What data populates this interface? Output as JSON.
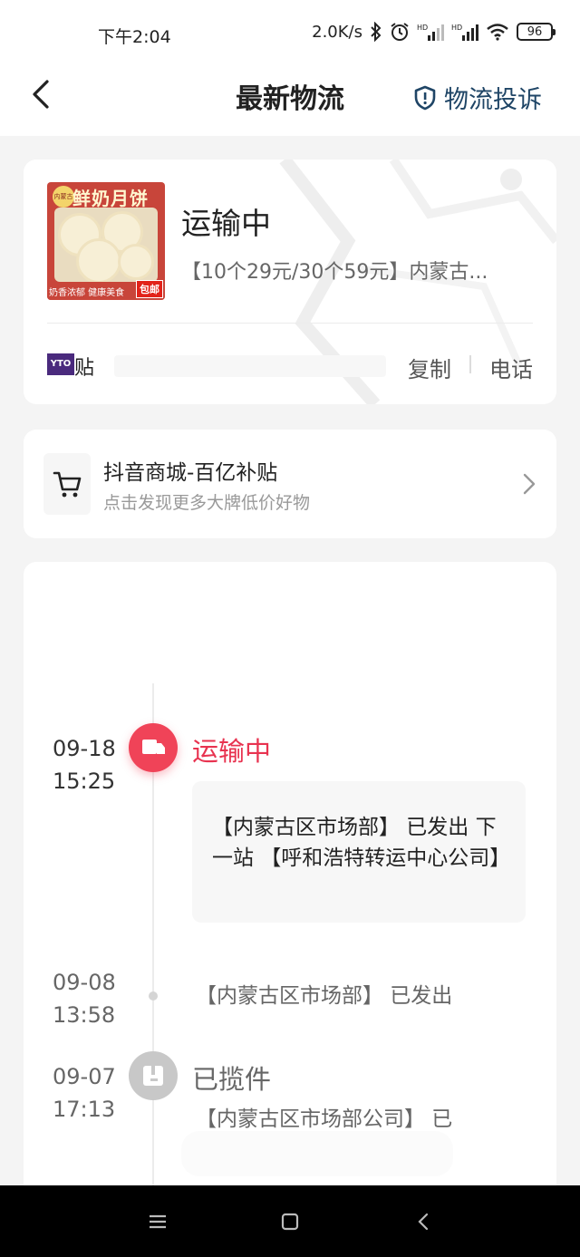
{
  "status_bar": {
    "time": "下午2:04",
    "net_speed": "2.0K/s",
    "battery": "96",
    "icons": [
      "bluetooth-icon",
      "alarm-icon",
      "signal-icon",
      "signal-icon",
      "wifi-icon",
      "battery-icon"
    ]
  },
  "header": {
    "title": "最新物流",
    "complaint_label": "物流投诉",
    "icons": [
      "back-icon",
      "shield-icon"
    ]
  },
  "product": {
    "thumb_title": "鲜奶月饼",
    "thumb_brand": "内蒙古",
    "thumb_footer": "奶香浓郁 健康美食",
    "thumb_badge": "包邮",
    "status": "运输中",
    "name": "【10个29元/30个59元】内蒙古...",
    "courier_logo_text": "YTO",
    "courier_suffix": "贴",
    "copy_label": "复制",
    "phone_label": "电话"
  },
  "promo": {
    "title": "抖音商城-百亿补贴",
    "subtitle": "点击发现更多大牌低价好物",
    "icons": [
      "cart-icon",
      "chevron-right-icon"
    ]
  },
  "timeline": [
    {
      "date": "09-18",
      "time": "15:25",
      "status": "运输中",
      "detail": "【内蒙古区市场部】 已发出 下一站 【呼和浩特转运中心公司】",
      "icon": "truck-icon",
      "color": "#f04358"
    },
    {
      "date": "09-08",
      "time": "13:58",
      "status": "",
      "detail": "【内蒙古区市场部】 已发出"
    },
    {
      "date": "09-07",
      "time": "17:13",
      "status": "已揽件",
      "detail": "【内蒙古区市场部公司】 已",
      "icon": "package-icon"
    }
  ],
  "nav_bar": {
    "icons": [
      "menu-icon",
      "home-icon",
      "back-nav-icon"
    ]
  },
  "colors": {
    "accent": "#f04358",
    "link": "#1f4566",
    "background": "#f4f4f4"
  }
}
